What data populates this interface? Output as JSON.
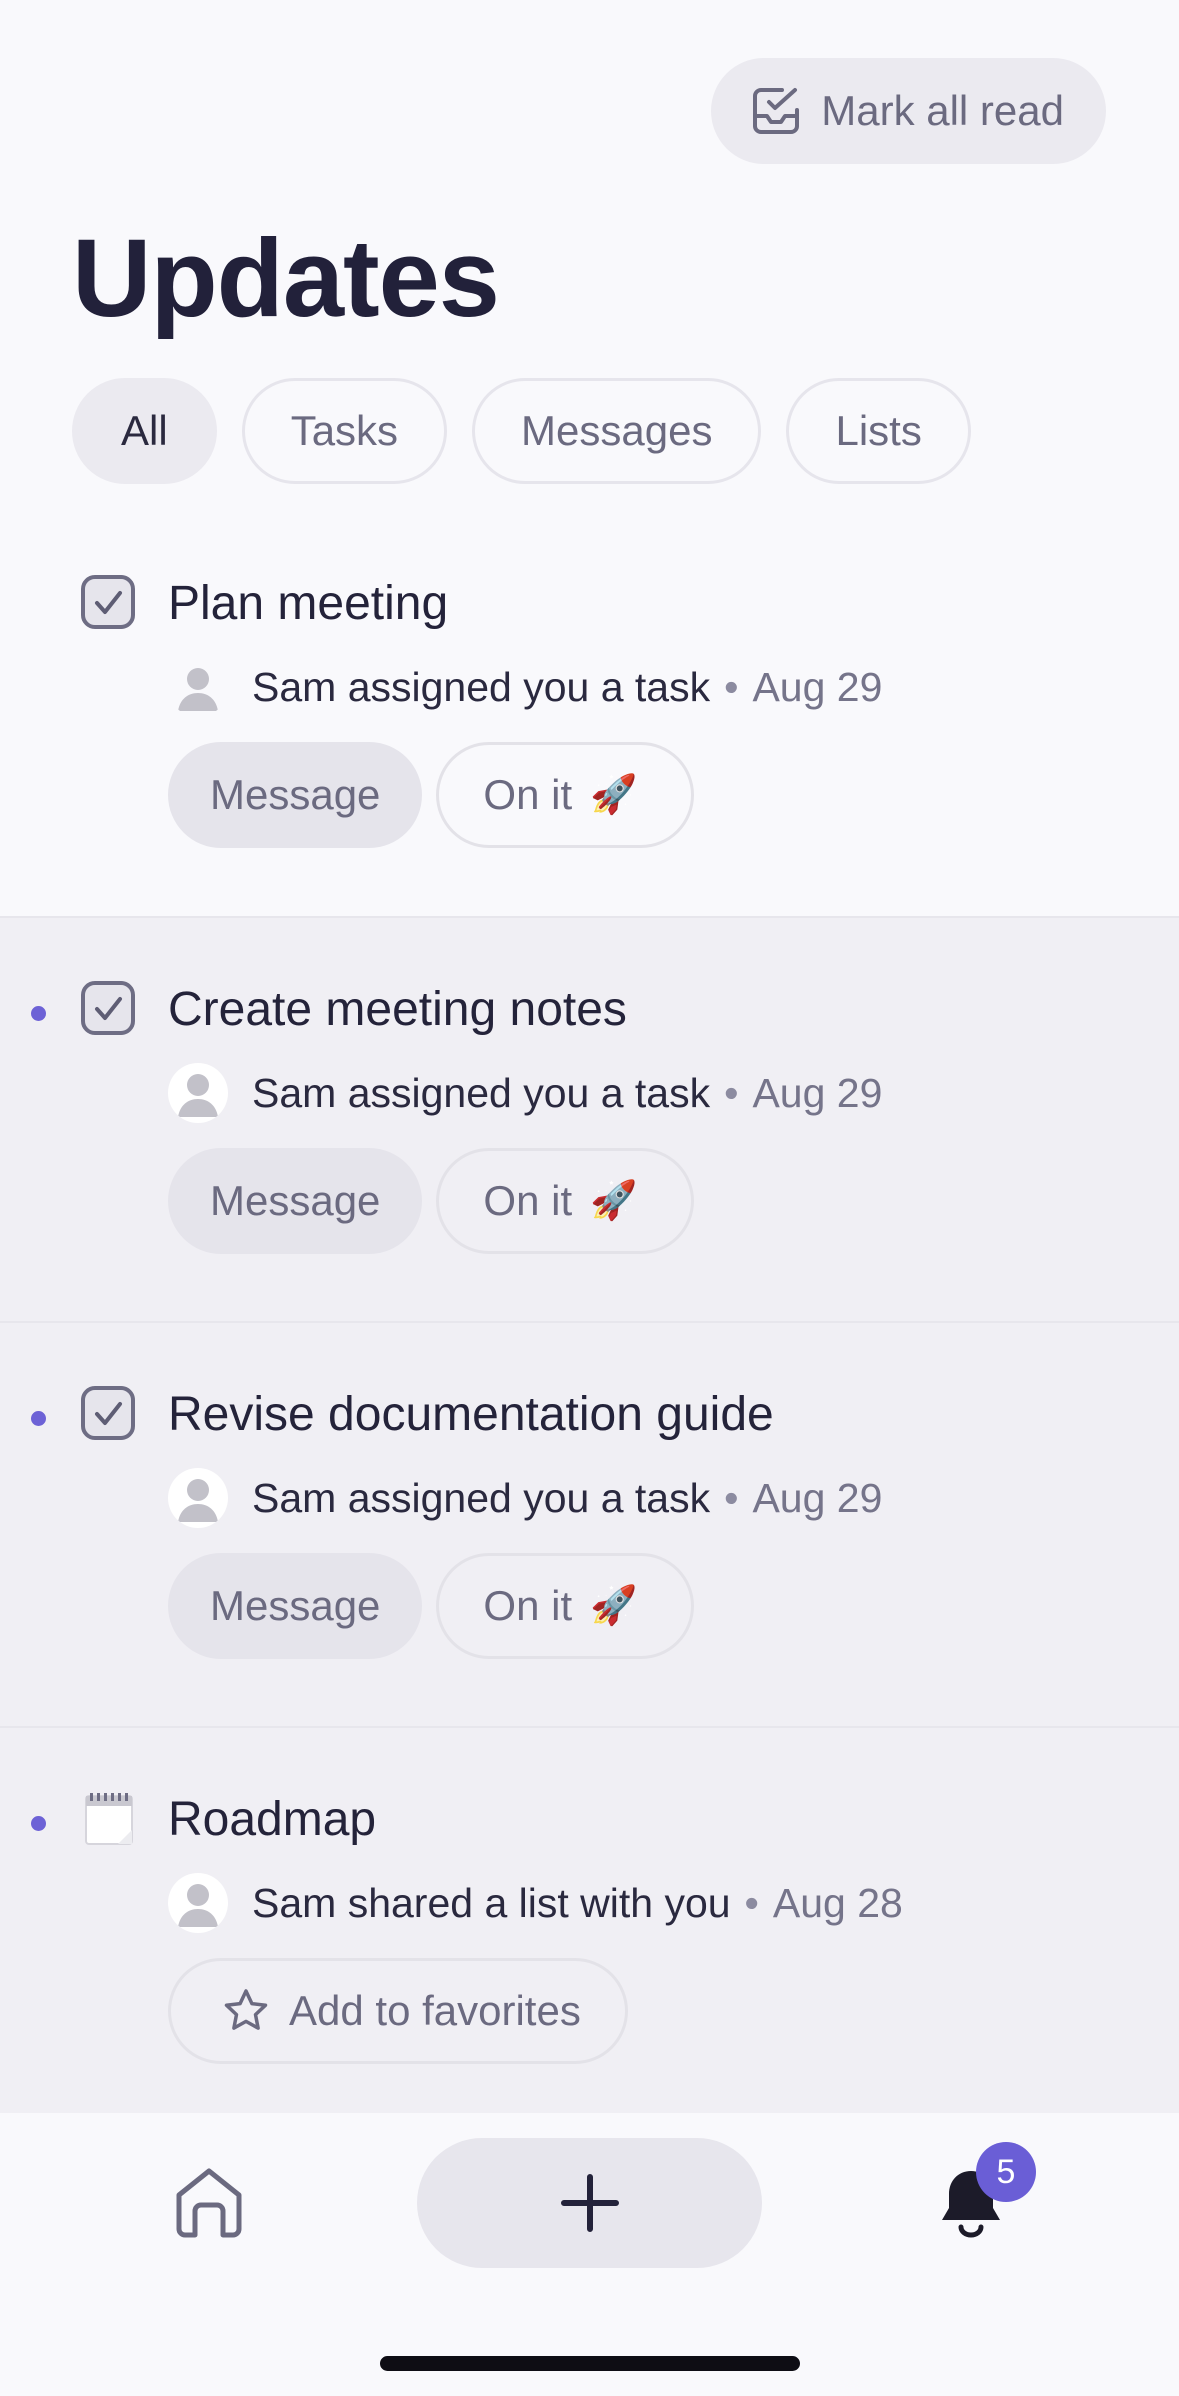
{
  "header": {
    "mark_all_label": "Mark all read",
    "title": "Updates"
  },
  "filters": [
    "All",
    "Tasks",
    "Messages",
    "Lists"
  ],
  "items": [
    {
      "title": "Plan meeting",
      "meta": "Sam assigned you a task",
      "date": "Aug 29",
      "actions": [
        "Message",
        "On it"
      ]
    },
    {
      "title": "Create meeting notes",
      "meta": "Sam assigned you a task",
      "date": "Aug 29",
      "actions": [
        "Message",
        "On it"
      ]
    },
    {
      "title": "Revise documentation guide",
      "meta": "Sam assigned you a task",
      "date": "Aug 29",
      "actions": [
        "Message",
        "On it"
      ]
    },
    {
      "title": "Roadmap",
      "meta": "Sam shared a list with you",
      "date": "Aug 28",
      "actions": [
        "Add to favorites"
      ]
    }
  ],
  "separator": "•",
  "rocket": "🚀",
  "tab_bar": {
    "badge_count": "5"
  },
  "colors": {
    "accent": "#6a5ed6",
    "unread_bg": "#f0eff4",
    "background": "#f9f9fc"
  },
  "icons": [
    "checklist-icon",
    "checkbox-icon",
    "notepad-icon",
    "avatar-icon",
    "star-icon",
    "home-icon",
    "plus-icon",
    "bell-icon"
  ]
}
